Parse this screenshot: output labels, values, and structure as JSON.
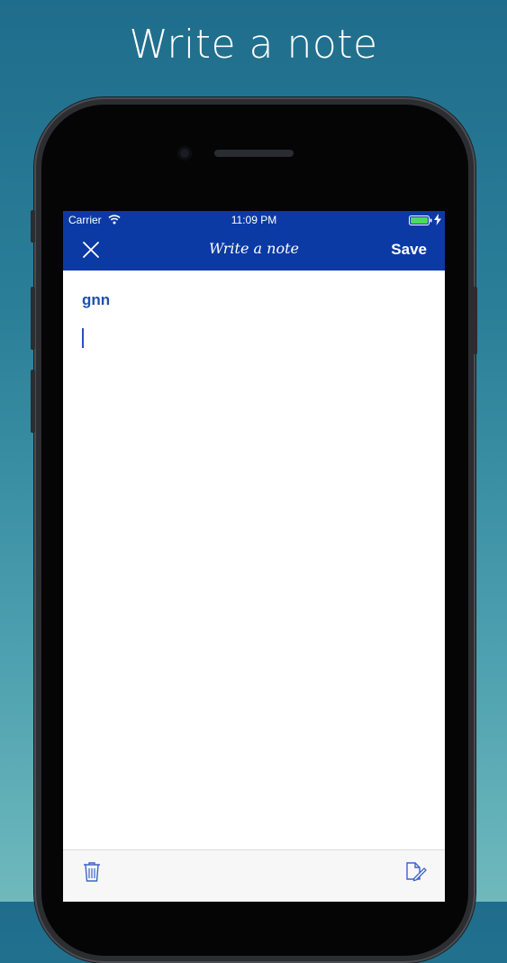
{
  "promo": {
    "headline": "Write a note"
  },
  "status_bar": {
    "carrier": "Carrier",
    "time": "11:09 PM",
    "battery_color": "#4cd964"
  },
  "nav_bar": {
    "close_icon": "close-icon",
    "title": "Write a note",
    "save_label": "Save",
    "color": "#0b3aa5"
  },
  "note": {
    "title": "gnn",
    "body": ""
  },
  "toolbar": {
    "left_icon": "trash-icon",
    "right_icon": "compose-icon"
  }
}
